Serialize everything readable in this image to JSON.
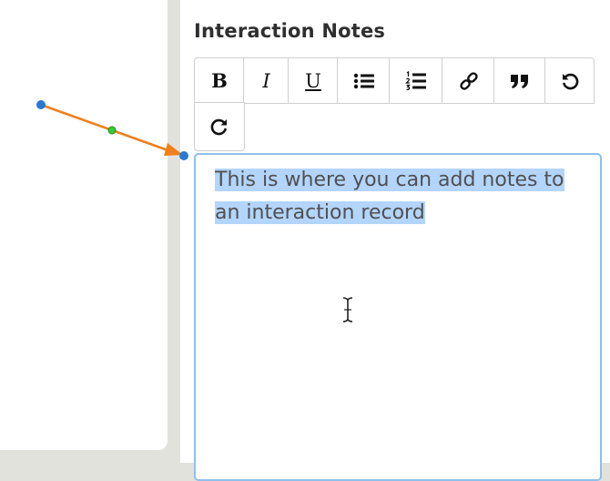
{
  "section": {
    "title": "Interaction Notes"
  },
  "toolbar": {
    "bold": "B",
    "italic": "I",
    "underline": "U"
  },
  "editor": {
    "line1": "This is where you can add notes to",
    "line2": "an interaction record"
  },
  "colors": {
    "connector_line": "#f07f1a",
    "connector_endpoint": "#2a78d4",
    "connector_midpoint": "#33cc33",
    "selection": "#b3d5fb",
    "editor_focus_border": "#8fc0ec"
  }
}
